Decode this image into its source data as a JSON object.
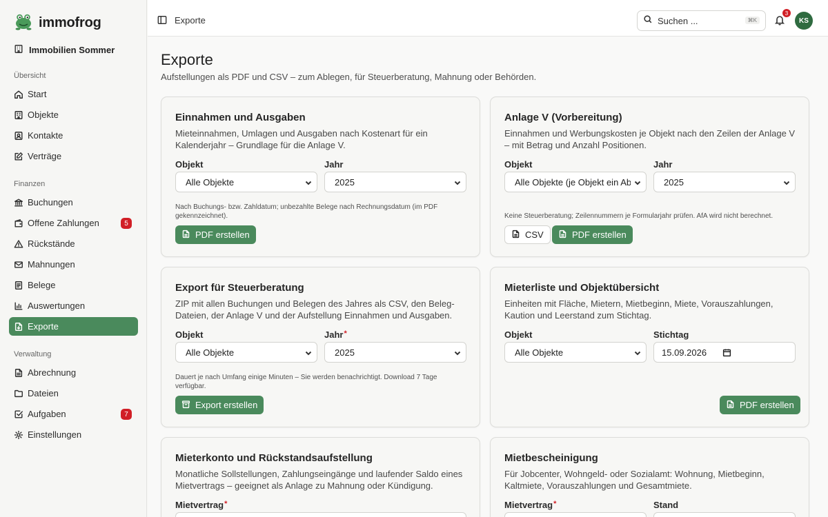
{
  "sidebar": {
    "brand": "immofrog",
    "org": "Immobilien Sommer",
    "sections": {
      "overview": "Übersicht",
      "finance": "Finanzen",
      "admin": "Verwaltung"
    },
    "items": {
      "start": "Start",
      "objekte": "Objekte",
      "kontakte": "Kontakte",
      "vertraege": "Verträge",
      "buchungen": "Buchungen",
      "offene": "Offene Zahlungen",
      "offene_badge": "5",
      "rueckstaende": "Rückstände",
      "mahnungen": "Mahnungen",
      "belege": "Belege",
      "auswertungen": "Auswertungen",
      "exporte": "Exporte",
      "abrechnung": "Abrechnung",
      "dateien": "Dateien",
      "aufgaben": "Aufgaben",
      "aufgaben_badge": "7",
      "einstellungen": "Einstellungen"
    }
  },
  "topbar": {
    "breadcrumb": "Exporte",
    "search_placeholder": "Suchen ...",
    "search_shortcut": "⌘K",
    "notifications_count": "3",
    "avatar_initials": "KS"
  },
  "page": {
    "title": "Exporte",
    "subtitle": "Aufstellungen als PDF und CSV – zum Ablegen, für Steuerberatung, Mahnung oder Behörden."
  },
  "cards": {
    "einnahmen": {
      "title": "Einnahmen und Ausgaben",
      "desc": "Mieteinnahmen, Umlagen und Ausgaben nach Kostenart für ein Kalenderjahr – Grundlage für die Anlage V.",
      "label_objekt": "Objekt",
      "label_jahr": "Jahr",
      "objekt_value": "Alle Objekte",
      "jahr_value": "2025",
      "hint": "Nach Buchungs- bzw. Zahldatum; unbezahlte Belege nach Rechnungsdatum (im PDF gekennzeichnet).",
      "pdf_button": "PDF erstellen"
    },
    "anlage_v": {
      "title": "Anlage V (Vorbereitung)",
      "desc": "Einnahmen und Werbungskosten je Objekt nach den Zeilen der Anlage V – mit Betrag und Anzahl Positionen.",
      "label_objekt": "Objekt",
      "label_jahr": "Jahr",
      "objekt_value": "Alle Objekte (je Objekt ein Abschnitt)",
      "jahr_value": "2025",
      "hint": "Keine Steuerberatung; Zeilennummern je Formularjahr prüfen. AfA wird nicht berechnet.",
      "csv_button": "CSV",
      "pdf_button": "PDF erstellen"
    },
    "steuer": {
      "title": "Export für Steuerberatung",
      "desc": "ZIP mit allen Buchungen und Belegen des Jahres als CSV, den Beleg-Dateien, der Anlage V und der Aufstellung Einnahmen und Ausgaben.",
      "label_objekt": "Objekt",
      "label_jahr": "Jahr",
      "objekt_value": "Alle Objekte",
      "jahr_value": "2025",
      "hint": "Dauert je nach Umfang einige Minuten – Sie werden benachrichtigt. Download 7 Tage verfügbar.",
      "export_button": "Export erstellen"
    },
    "mieterliste": {
      "title": "Mieterliste und Objektübersicht",
      "desc": "Einheiten mit Fläche, Mietern, Mietbeginn, Miete, Vorauszahlungen, Kaution und Leerstand zum Stichtag.",
      "label_objekt": "Objekt",
      "label_stichtag": "Stichtag",
      "objekt_value": "Alle Objekte",
      "stichtag_value": "15.09.2026",
      "pdf_button": "PDF erstellen"
    },
    "mieterkonto": {
      "title": "Mieterkonto und Rückstandsaufstellung",
      "desc": "Monatliche Sollstellungen, Zahlungseingänge und laufender Saldo eines Mietvertrags – geeignet als Anlage zu Mahnung oder Kündigung.",
      "label_mietvertrag": "Mietvertrag"
    },
    "mietbescheinigung": {
      "title": "Mietbescheinigung",
      "desc": "Für Jobcenter, Wohngeld- oder Sozialamt: Wohnung, Mietbeginn, Kaltmiete, Vorauszahlungen und Gesamtmiete.",
      "label_mietvertrag": "Mietvertrag",
      "label_stand": "Stand"
    }
  },
  "required_mark": "*",
  "colors": {
    "accent": "#4a8a5c",
    "badge": "#d11f26",
    "avatar": "#2f6b40"
  }
}
